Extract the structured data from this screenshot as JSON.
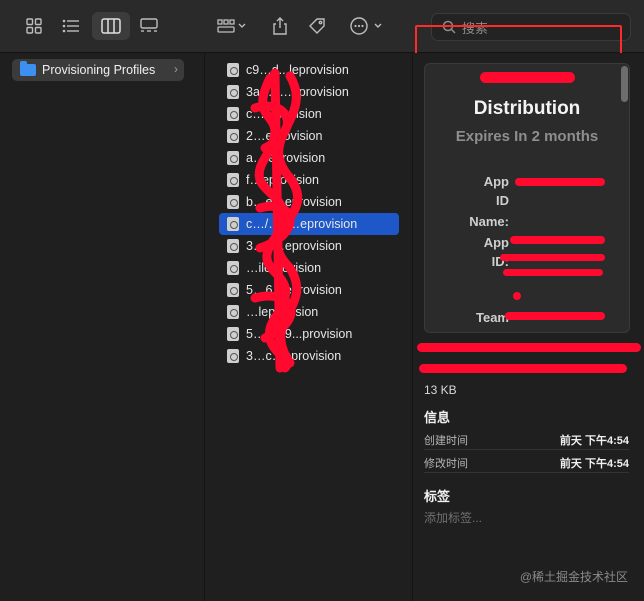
{
  "toolbar": {
    "views": [
      "icon-view",
      "list-view",
      "column-view",
      "gallery-view"
    ],
    "search_placeholder": "搜索"
  },
  "sidebar": {
    "folder_label": "Provisioning Profiles"
  },
  "files": [
    {
      "name": "c9…d...leprovision",
      "selected": false
    },
    {
      "name": "3a…6…eprovision",
      "selected": false
    },
    {
      "name": "c…eprovision",
      "selected": false
    },
    {
      "name": "2…eprovision",
      "selected": false
    },
    {
      "name": "a…leprovision",
      "selected": false
    },
    {
      "name": "f…eprovision",
      "selected": false
    },
    {
      "name": "b…e…eprovision",
      "selected": false
    },
    {
      "name": "c…/…3…eprovision",
      "selected": true
    },
    {
      "name": "3…e…eprovision",
      "selected": false
    },
    {
      "name": "…ileprovision",
      "selected": false
    },
    {
      "name": "5…6…eprovision",
      "selected": false
    },
    {
      "name": "…leprovision",
      "selected": false
    },
    {
      "name": "5…d…9...provision",
      "selected": false
    },
    {
      "name": "3…c…eprovision",
      "selected": false
    }
  ],
  "preview": {
    "title": "Distribution",
    "subtitle": "Expires In 2 months",
    "labels": {
      "app_id_name_1": "App",
      "app_id_name_2": "ID",
      "app_id_name_3": "Name:",
      "app_id_1": "App",
      "app_id_2": "ID:",
      "team": "Team"
    },
    "file_size": "13 KB",
    "info_heading": "信息",
    "created_label": "创建时间",
    "created_value": "前天 下午4:54",
    "modified_label": "修改时间",
    "modified_value": "前天 下午4:54",
    "tags_heading": "标签",
    "tags_placeholder": "添加标签..."
  },
  "watermark": "@稀土掘金技术社区"
}
